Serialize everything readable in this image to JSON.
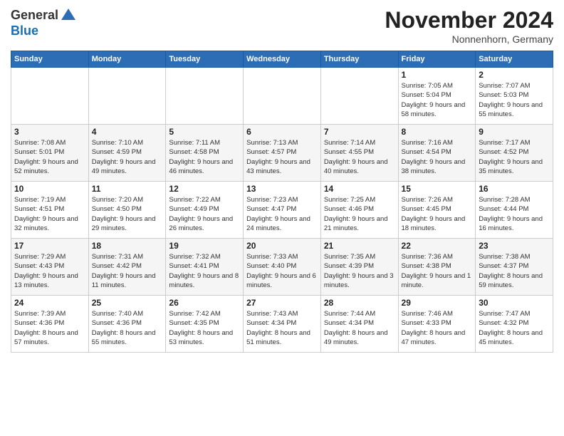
{
  "logo": {
    "general": "General",
    "blue": "Blue"
  },
  "header": {
    "month": "November 2024",
    "location": "Nonnenhorn, Germany"
  },
  "weekdays": [
    "Sunday",
    "Monday",
    "Tuesday",
    "Wednesday",
    "Thursday",
    "Friday",
    "Saturday"
  ],
  "weeks": [
    [
      {
        "day": "",
        "info": ""
      },
      {
        "day": "",
        "info": ""
      },
      {
        "day": "",
        "info": ""
      },
      {
        "day": "",
        "info": ""
      },
      {
        "day": "",
        "info": ""
      },
      {
        "day": "1",
        "info": "Sunrise: 7:05 AM\nSunset: 5:04 PM\nDaylight: 9 hours and 58 minutes."
      },
      {
        "day": "2",
        "info": "Sunrise: 7:07 AM\nSunset: 5:03 PM\nDaylight: 9 hours and 55 minutes."
      }
    ],
    [
      {
        "day": "3",
        "info": "Sunrise: 7:08 AM\nSunset: 5:01 PM\nDaylight: 9 hours and 52 minutes."
      },
      {
        "day": "4",
        "info": "Sunrise: 7:10 AM\nSunset: 4:59 PM\nDaylight: 9 hours and 49 minutes."
      },
      {
        "day": "5",
        "info": "Sunrise: 7:11 AM\nSunset: 4:58 PM\nDaylight: 9 hours and 46 minutes."
      },
      {
        "day": "6",
        "info": "Sunrise: 7:13 AM\nSunset: 4:57 PM\nDaylight: 9 hours and 43 minutes."
      },
      {
        "day": "7",
        "info": "Sunrise: 7:14 AM\nSunset: 4:55 PM\nDaylight: 9 hours and 40 minutes."
      },
      {
        "day": "8",
        "info": "Sunrise: 7:16 AM\nSunset: 4:54 PM\nDaylight: 9 hours and 38 minutes."
      },
      {
        "day": "9",
        "info": "Sunrise: 7:17 AM\nSunset: 4:52 PM\nDaylight: 9 hours and 35 minutes."
      }
    ],
    [
      {
        "day": "10",
        "info": "Sunrise: 7:19 AM\nSunset: 4:51 PM\nDaylight: 9 hours and 32 minutes."
      },
      {
        "day": "11",
        "info": "Sunrise: 7:20 AM\nSunset: 4:50 PM\nDaylight: 9 hours and 29 minutes."
      },
      {
        "day": "12",
        "info": "Sunrise: 7:22 AM\nSunset: 4:49 PM\nDaylight: 9 hours and 26 minutes."
      },
      {
        "day": "13",
        "info": "Sunrise: 7:23 AM\nSunset: 4:47 PM\nDaylight: 9 hours and 24 minutes."
      },
      {
        "day": "14",
        "info": "Sunrise: 7:25 AM\nSunset: 4:46 PM\nDaylight: 9 hours and 21 minutes."
      },
      {
        "day": "15",
        "info": "Sunrise: 7:26 AM\nSunset: 4:45 PM\nDaylight: 9 hours and 18 minutes."
      },
      {
        "day": "16",
        "info": "Sunrise: 7:28 AM\nSunset: 4:44 PM\nDaylight: 9 hours and 16 minutes."
      }
    ],
    [
      {
        "day": "17",
        "info": "Sunrise: 7:29 AM\nSunset: 4:43 PM\nDaylight: 9 hours and 13 minutes."
      },
      {
        "day": "18",
        "info": "Sunrise: 7:31 AM\nSunset: 4:42 PM\nDaylight: 9 hours and 11 minutes."
      },
      {
        "day": "19",
        "info": "Sunrise: 7:32 AM\nSunset: 4:41 PM\nDaylight: 9 hours and 8 minutes."
      },
      {
        "day": "20",
        "info": "Sunrise: 7:33 AM\nSunset: 4:40 PM\nDaylight: 9 hours and 6 minutes."
      },
      {
        "day": "21",
        "info": "Sunrise: 7:35 AM\nSunset: 4:39 PM\nDaylight: 9 hours and 3 minutes."
      },
      {
        "day": "22",
        "info": "Sunrise: 7:36 AM\nSunset: 4:38 PM\nDaylight: 9 hours and 1 minute."
      },
      {
        "day": "23",
        "info": "Sunrise: 7:38 AM\nSunset: 4:37 PM\nDaylight: 8 hours and 59 minutes."
      }
    ],
    [
      {
        "day": "24",
        "info": "Sunrise: 7:39 AM\nSunset: 4:36 PM\nDaylight: 8 hours and 57 minutes."
      },
      {
        "day": "25",
        "info": "Sunrise: 7:40 AM\nSunset: 4:36 PM\nDaylight: 8 hours and 55 minutes."
      },
      {
        "day": "26",
        "info": "Sunrise: 7:42 AM\nSunset: 4:35 PM\nDaylight: 8 hours and 53 minutes."
      },
      {
        "day": "27",
        "info": "Sunrise: 7:43 AM\nSunset: 4:34 PM\nDaylight: 8 hours and 51 minutes."
      },
      {
        "day": "28",
        "info": "Sunrise: 7:44 AM\nSunset: 4:34 PM\nDaylight: 8 hours and 49 minutes."
      },
      {
        "day": "29",
        "info": "Sunrise: 7:46 AM\nSunset: 4:33 PM\nDaylight: 8 hours and 47 minutes."
      },
      {
        "day": "30",
        "info": "Sunrise: 7:47 AM\nSunset: 4:32 PM\nDaylight: 8 hours and 45 minutes."
      }
    ]
  ]
}
